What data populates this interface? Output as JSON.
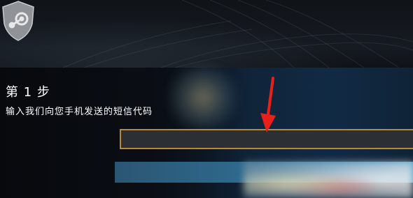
{
  "step": {
    "title": "第 1 步",
    "description": "输入我们向您手机发送的短信代码"
  },
  "code_input": {
    "value": "",
    "placeholder": ""
  },
  "submit_button": {
    "label": ""
  },
  "icons": {
    "logo": "steam-shield-icon",
    "annotation": "red-arrow-icon"
  },
  "colors": {
    "input_border": "#b88a33",
    "arrow": "#e8201a",
    "button": "#2e6a8e"
  }
}
